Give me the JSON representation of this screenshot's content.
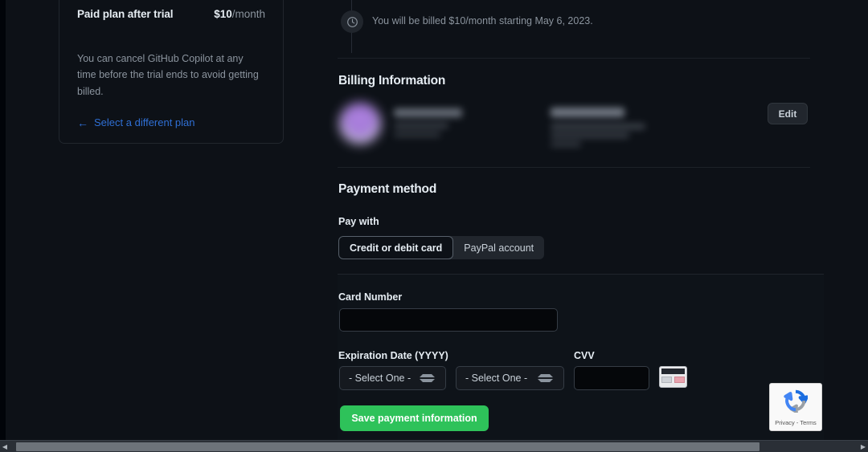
{
  "plan_card": {
    "title": "Paid plan after trial",
    "price_amount": "$10",
    "price_period": "/month",
    "description": "You can cancel GitHub Copilot at any time before the trial ends to avoid getting billed.",
    "link_label": "Select a different plan",
    "link_icon": "arrow-left-icon",
    "link_color": "#2f6fd4"
  },
  "timeline": {
    "icon": "clock-icon",
    "notice": "You will be billed $10/month starting May 6, 2023."
  },
  "billing": {
    "section_title": "Billing Information",
    "edit_label": "Edit",
    "avatar": "user-avatar",
    "redacted": true
  },
  "payment_method": {
    "section_title": "Payment method",
    "pay_with_label": "Pay with",
    "tabs": [
      {
        "label": "Credit or debit card",
        "selected": true
      },
      {
        "label": "PayPal account",
        "selected": false
      }
    ]
  },
  "card_form": {
    "card_number_label": "Card Number",
    "card_number_value": "",
    "expiration_label": "Expiration Date (YYYY)",
    "month_value": "- Select One -",
    "year_value": "- Select One -",
    "cvv_label": "CVV",
    "cvv_value": "",
    "cvv_icon": "credit-card-back-icon",
    "save_label": "Save payment information",
    "save_color": "#2ec25a"
  },
  "recaptcha": {
    "icon": "recaptcha-icon",
    "footer": "Privacy - Terms"
  },
  "scrollbar": {
    "left_arrow": "◀",
    "right_arrow": "▶"
  }
}
